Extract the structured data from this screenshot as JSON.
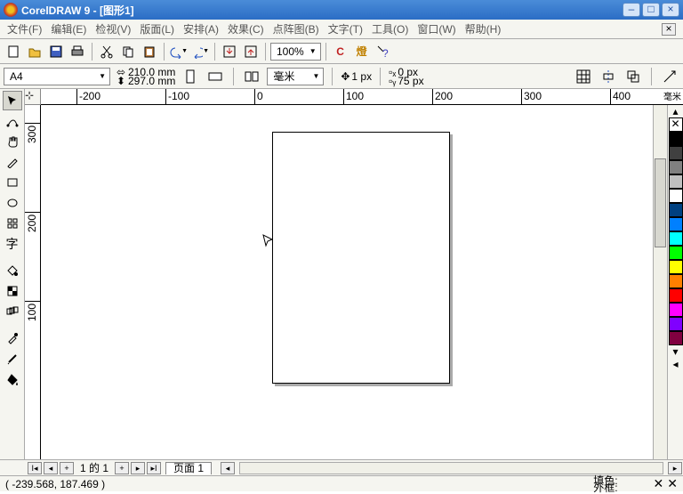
{
  "titlebar": {
    "title": "CorelDRAW 9 - [图形1]"
  },
  "menubar": {
    "items": [
      "文件(F)",
      "编辑(E)",
      "检视(V)",
      "版面(L)",
      "安排(A)",
      "效果(C)",
      "点阵图(B)",
      "文字(T)",
      "工具(O)",
      "窗口(W)",
      "帮助(H)"
    ]
  },
  "toolbar": {
    "zoom_value": "100%"
  },
  "propbar": {
    "paper": "A4",
    "width": "210.0 mm",
    "height": "297.0 mm",
    "units": "毫米",
    "nudge": "1 px",
    "dup_x": "0 px",
    "dup_y": "75 px"
  },
  "ruler": {
    "h": [
      "-200",
      "-100",
      "0",
      "100",
      "200",
      "300",
      "400"
    ],
    "v": [
      "300",
      "200",
      "100"
    ],
    "units_label": "毫米"
  },
  "pagenav": {
    "text": "1 的 1",
    "tab": "页面  1"
  },
  "status": {
    "coords": "( -239.568, 187.469 )",
    "fill_label": "填色:",
    "outline_label": "外框:"
  },
  "palette": {
    "colors": [
      "#000000",
      "#404040",
      "#808080",
      "#c0c0c0",
      "#ffffff",
      "#004080",
      "#0080ff",
      "#00ffff",
      "#00ff00",
      "#ffff00",
      "#ff8000",
      "#ff0000",
      "#ff00ff",
      "#8000ff",
      "#800040"
    ]
  }
}
